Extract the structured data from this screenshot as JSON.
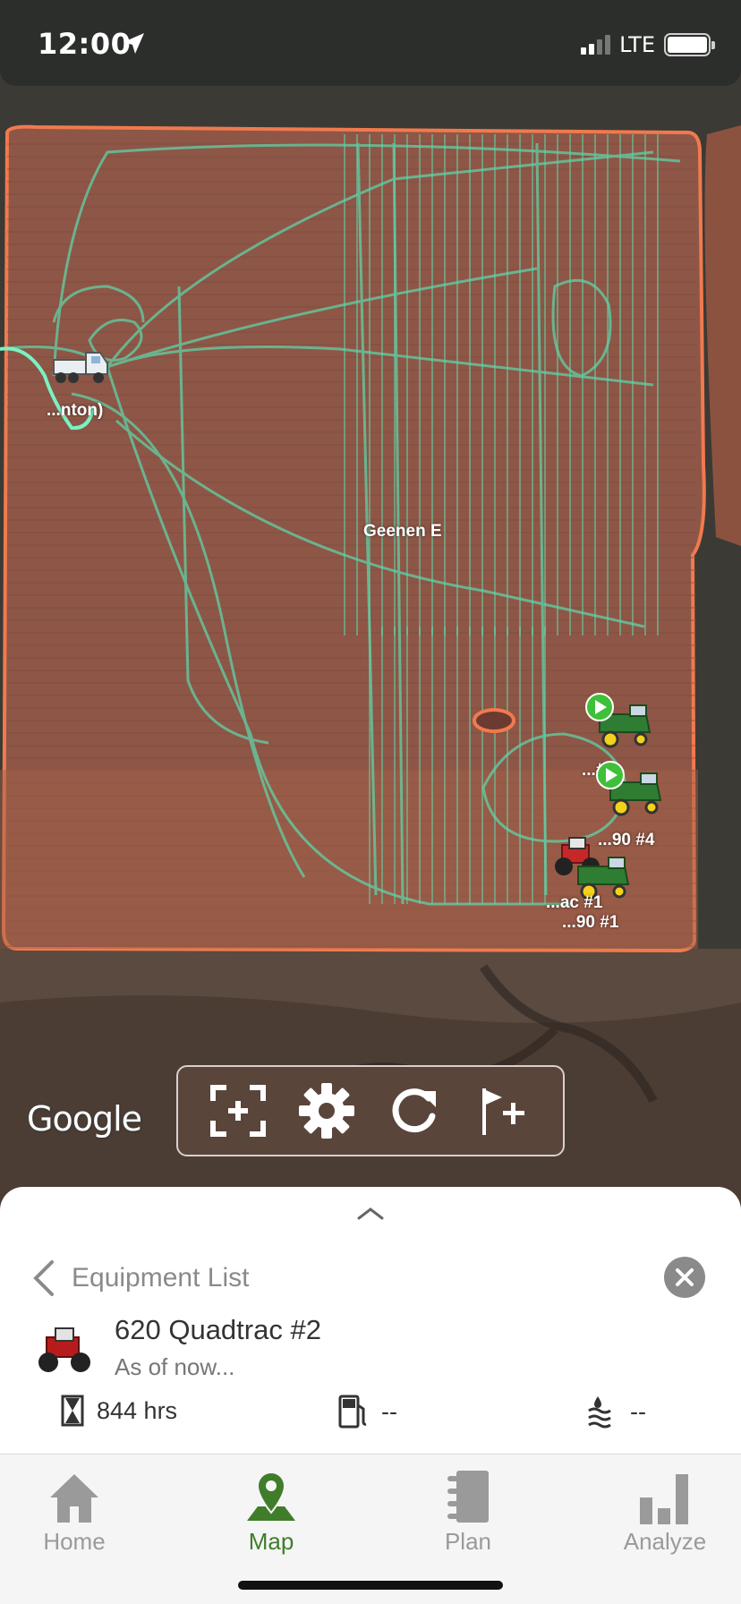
{
  "status_bar": {
    "time": "12:00",
    "network": "LTE",
    "signal_bars_filled": 2,
    "battery_level": 1.0,
    "location_icon": "location-arrow-icon"
  },
  "map": {
    "field_name": "Geenen E",
    "field_outline_color": "#f07a4e",
    "track_color": "#5fd3a8",
    "provider_logo": "Google",
    "equipment_labels": {
      "truck": "...nton)",
      "combine_3": "...#3",
      "combine_4": "...90 #4",
      "tractor_1": "...ac #1",
      "combine_1": "...90 #1"
    },
    "toolbar": {
      "fit_icon": "fit-extent-icon",
      "settings_icon": "gear-icon",
      "refresh_icon": "refresh-icon",
      "add_flag_icon": "flag-plus-icon"
    }
  },
  "sheet": {
    "back_label": "Equipment List",
    "equipment_name": "620 Quadtrac #2",
    "as_of": "As of now...",
    "stats": {
      "hours": "844 hrs",
      "fuel": "--",
      "def": "--"
    }
  },
  "tabs": [
    {
      "label": "Home",
      "icon": "home-icon",
      "active": false
    },
    {
      "label": "Map",
      "icon": "map-pin-icon",
      "active": true
    },
    {
      "label": "Plan",
      "icon": "notebook-icon",
      "active": false
    },
    {
      "label": "Analyze",
      "icon": "bar-chart-icon",
      "active": false
    }
  ],
  "colors": {
    "accent_green": "#3f7d2b",
    "toolbar_brown": "#5a453b",
    "inactive_gray": "#9a9a9a"
  }
}
